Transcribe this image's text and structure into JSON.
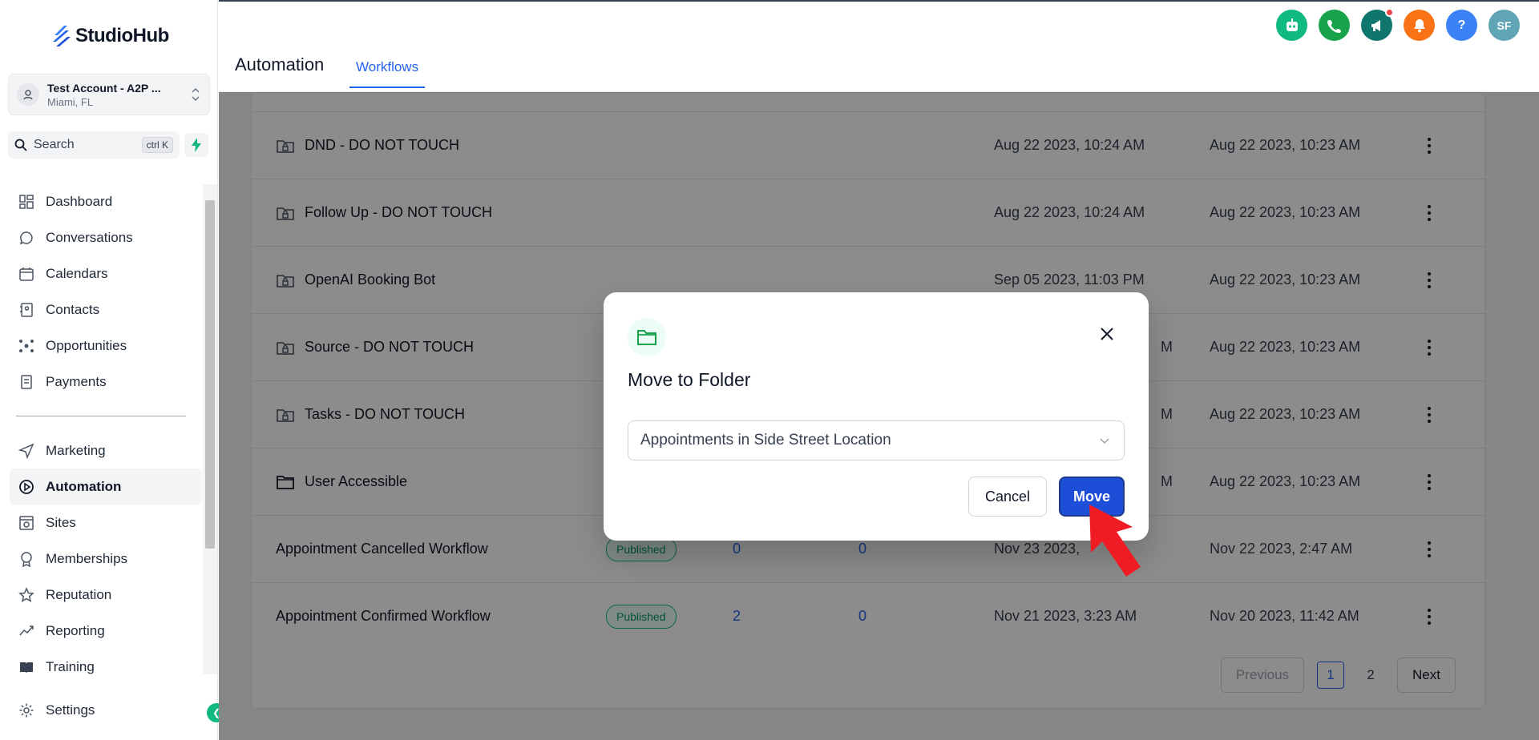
{
  "brand": {
    "name": "StudioHub",
    "accent": "#10b981",
    "primary": "#1d4ed8"
  },
  "account": {
    "name": "Test Account - A2P ...",
    "location": "Miami, FL"
  },
  "search": {
    "label": "Search",
    "shortcut": "ctrl K"
  },
  "sidebar": {
    "items": [
      {
        "label": "Dashboard",
        "icon": "dashboard-icon"
      },
      {
        "label": "Conversations",
        "icon": "chat-icon"
      },
      {
        "label": "Calendars",
        "icon": "calendar-icon"
      },
      {
        "label": "Contacts",
        "icon": "contacts-icon"
      },
      {
        "label": "Opportunities",
        "icon": "opportunities-icon"
      },
      {
        "label": "Payments",
        "icon": "payments-icon"
      },
      {
        "label": "Marketing",
        "icon": "send-icon"
      },
      {
        "label": "Automation",
        "icon": "automation-icon",
        "active": true
      },
      {
        "label": "Sites",
        "icon": "sites-icon"
      },
      {
        "label": "Memberships",
        "icon": "memberships-icon"
      },
      {
        "label": "Reputation",
        "icon": "star-icon"
      },
      {
        "label": "Reporting",
        "icon": "reporting-icon"
      },
      {
        "label": "Training",
        "icon": "book-icon"
      }
    ],
    "settings": "Settings"
  },
  "header": {
    "title": "Automation",
    "tab": "Workflows",
    "avatar_initials": "SF",
    "help": "?"
  },
  "table": {
    "rows": [
      {
        "name": "DND - DO NOT TOUCH",
        "type": "locked-folder",
        "updated": "Aug 22 2023, 10:24 AM",
        "created": "Aug 22 2023, 10:23 AM"
      },
      {
        "name": "Follow Up - DO NOT TOUCH",
        "type": "locked-folder",
        "updated": "Aug 22 2023, 10:24 AM",
        "created": "Aug 22 2023, 10:23 AM"
      },
      {
        "name": "OpenAI Booking Bot",
        "type": "locked-folder",
        "updated": "Sep 05 2023, 11:03 PM",
        "created": "Aug 22 2023, 10:23 AM"
      },
      {
        "name": "Source - DO NOT TOUCH",
        "type": "locked-folder",
        "updated": "M",
        "created": "Aug 22 2023, 10:23 AM"
      },
      {
        "name": "Tasks - DO NOT TOUCH",
        "type": "locked-folder",
        "updated": "M",
        "created": "Aug 22 2023, 10:23 AM"
      },
      {
        "name": "User Accessible",
        "type": "folder",
        "updated": "M",
        "created": "Aug 22 2023, 10:23 AM"
      },
      {
        "name": "Appointment Cancelled Workflow",
        "type": "workflow",
        "status": "Published",
        "enrolled": "0",
        "completed": "0",
        "updated": "Nov 23 2023,",
        "created": "Nov 22 2023, 2:47 AM"
      },
      {
        "name": "Appointment Confirmed Workflow",
        "type": "workflow",
        "status": "Published",
        "enrolled": "2",
        "completed": "0",
        "updated": "Nov 21 2023, 3:23 AM",
        "created": "Nov 20 2023, 11:42 AM"
      }
    ]
  },
  "pagination": {
    "previous": "Previous",
    "pages": [
      "1",
      "2"
    ],
    "current": "1",
    "next": "Next"
  },
  "modal": {
    "title": "Move to Folder",
    "selected_folder": "Appointments in Side Street Location",
    "cancel": "Cancel",
    "move": "Move"
  }
}
